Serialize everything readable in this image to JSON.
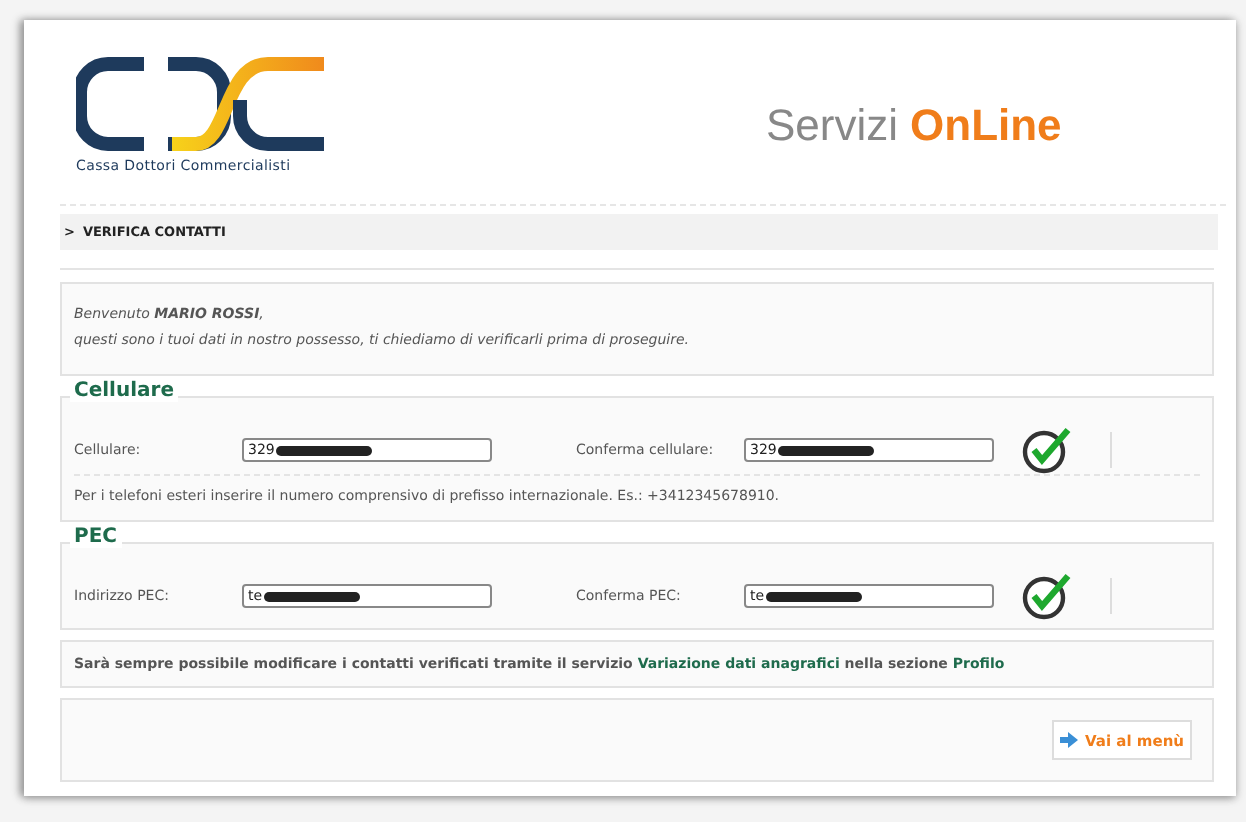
{
  "header": {
    "logo_caption": "Cassa Dottori Commercialisti",
    "title_plain": "Servizi",
    "title_accent": "OnLine"
  },
  "breadcrumb": {
    "marker": ">",
    "label": "VERIFICA CONTATTI"
  },
  "intro": {
    "greeting": "Benvenuto **MARIO ROSSI**,",
    "text": "questi sono i tuoi dati in nostro possesso, ti chiediamo di verificarli prima di proseguire."
  },
  "sections": [
    {
      "legend": "Cellulare",
      "label": "Cellulare:",
      "value": "329",
      "confirm_label": "Conferma cellulare:",
      "confirm_value": "329",
      "verified": true,
      "note": "Per i telefoni esteri inserire il numero comprensivo di prefisso internazionale. Es.: +3412345678910."
    },
    {
      "legend": "PEC",
      "label": "Indirizzo PEC:",
      "value": "te",
      "confirm_label": "Conferma PEC:",
      "confirm_value": "te",
      "verified": true
    }
  ],
  "notice": {
    "before": "Sarà sempre possibile modificare i contatti verificati tramite il servizio",
    "link1": "Variazione dati anagrafici",
    "middle": "nella sezione",
    "link2": "Profilo"
  },
  "button": {
    "label": "Vai al menù"
  }
}
